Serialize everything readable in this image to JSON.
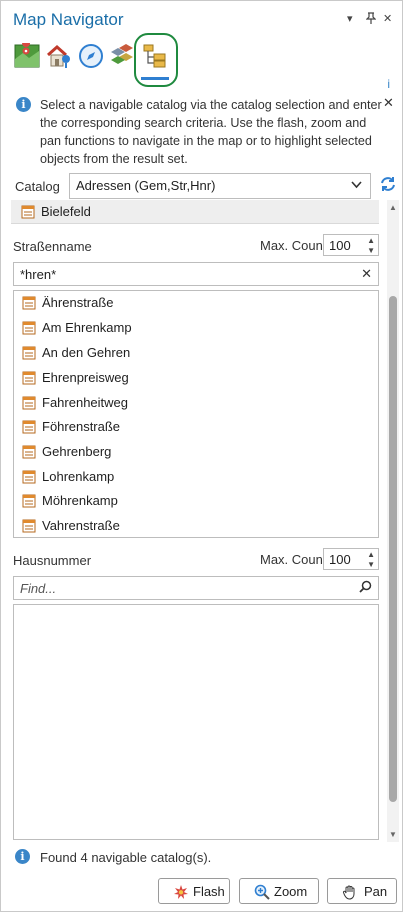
{
  "window": {
    "title": "Map Navigator",
    "controls": {
      "dropdown": "▾",
      "pin": "📌",
      "close": "✕"
    }
  },
  "toolbar": {
    "tools": [
      {
        "icon": "map-layer-icon"
      },
      {
        "icon": "house-location-icon"
      },
      {
        "icon": "compass-icon"
      },
      {
        "icon": "tiles-icon"
      },
      {
        "icon": "catalog-tree-icon",
        "active": true
      }
    ],
    "help": "i"
  },
  "info": {
    "icon": "i",
    "message": "Select a navigable catalog via the catalog selection and enter the corresponding search criteria. Use the flash, zoom and pan functions to navigate in the map or to highlight selected objects from the result set.",
    "close": "✕"
  },
  "catalog": {
    "label": "Catalog",
    "selected": "Adressen (Gem,Str,Hnr)",
    "breadcrumb": "Bielefeld"
  },
  "street": {
    "label": "Straßenname",
    "max_count_label": "Max. Count",
    "max_count": "100",
    "filter": "*hren*",
    "clear": "✕",
    "results": [
      "Ährenstraße",
      "Am Ehrenkamp",
      "An den Gehren",
      "Ehrenpreisweg",
      "Fahrenheitweg",
      "Föhrenstraße",
      "Gehrenberg",
      "Lohrenkamp",
      "Möhrenkamp",
      "Vahrenstraße"
    ]
  },
  "house": {
    "label": "Hausnummer",
    "max_count_label": "Max. Count",
    "max_count": "100",
    "placeholder": "Find..."
  },
  "status": {
    "icon": "i",
    "text": "Found 4 navigable catalog(s)."
  },
  "actions": {
    "flash": "Flash",
    "zoom": "Zoom",
    "pan": "Pan"
  },
  "colors": {
    "accent": "#1a6ea8",
    "active_tab": "#2f7fd1",
    "highlight_ring": "#1f8a3f"
  }
}
